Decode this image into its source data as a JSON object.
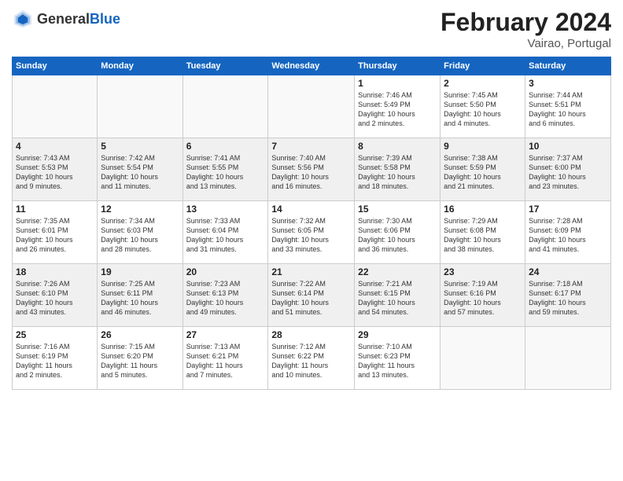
{
  "header": {
    "logo_general": "General",
    "logo_blue": "Blue",
    "month_year": "February 2024",
    "location": "Vairao, Portugal"
  },
  "days_of_week": [
    "Sunday",
    "Monday",
    "Tuesday",
    "Wednesday",
    "Thursday",
    "Friday",
    "Saturday"
  ],
  "weeks": [
    {
      "shaded": false,
      "days": [
        {
          "number": "",
          "info": ""
        },
        {
          "number": "",
          "info": ""
        },
        {
          "number": "",
          "info": ""
        },
        {
          "number": "",
          "info": ""
        },
        {
          "number": "1",
          "info": "Sunrise: 7:46 AM\nSunset: 5:49 PM\nDaylight: 10 hours\nand 2 minutes."
        },
        {
          "number": "2",
          "info": "Sunrise: 7:45 AM\nSunset: 5:50 PM\nDaylight: 10 hours\nand 4 minutes."
        },
        {
          "number": "3",
          "info": "Sunrise: 7:44 AM\nSunset: 5:51 PM\nDaylight: 10 hours\nand 6 minutes."
        }
      ]
    },
    {
      "shaded": true,
      "days": [
        {
          "number": "4",
          "info": "Sunrise: 7:43 AM\nSunset: 5:53 PM\nDaylight: 10 hours\nand 9 minutes."
        },
        {
          "number": "5",
          "info": "Sunrise: 7:42 AM\nSunset: 5:54 PM\nDaylight: 10 hours\nand 11 minutes."
        },
        {
          "number": "6",
          "info": "Sunrise: 7:41 AM\nSunset: 5:55 PM\nDaylight: 10 hours\nand 13 minutes."
        },
        {
          "number": "7",
          "info": "Sunrise: 7:40 AM\nSunset: 5:56 PM\nDaylight: 10 hours\nand 16 minutes."
        },
        {
          "number": "8",
          "info": "Sunrise: 7:39 AM\nSunset: 5:58 PM\nDaylight: 10 hours\nand 18 minutes."
        },
        {
          "number": "9",
          "info": "Sunrise: 7:38 AM\nSunset: 5:59 PM\nDaylight: 10 hours\nand 21 minutes."
        },
        {
          "number": "10",
          "info": "Sunrise: 7:37 AM\nSunset: 6:00 PM\nDaylight: 10 hours\nand 23 minutes."
        }
      ]
    },
    {
      "shaded": false,
      "days": [
        {
          "number": "11",
          "info": "Sunrise: 7:35 AM\nSunset: 6:01 PM\nDaylight: 10 hours\nand 26 minutes."
        },
        {
          "number": "12",
          "info": "Sunrise: 7:34 AM\nSunset: 6:03 PM\nDaylight: 10 hours\nand 28 minutes."
        },
        {
          "number": "13",
          "info": "Sunrise: 7:33 AM\nSunset: 6:04 PM\nDaylight: 10 hours\nand 31 minutes."
        },
        {
          "number": "14",
          "info": "Sunrise: 7:32 AM\nSunset: 6:05 PM\nDaylight: 10 hours\nand 33 minutes."
        },
        {
          "number": "15",
          "info": "Sunrise: 7:30 AM\nSunset: 6:06 PM\nDaylight: 10 hours\nand 36 minutes."
        },
        {
          "number": "16",
          "info": "Sunrise: 7:29 AM\nSunset: 6:08 PM\nDaylight: 10 hours\nand 38 minutes."
        },
        {
          "number": "17",
          "info": "Sunrise: 7:28 AM\nSunset: 6:09 PM\nDaylight: 10 hours\nand 41 minutes."
        }
      ]
    },
    {
      "shaded": true,
      "days": [
        {
          "number": "18",
          "info": "Sunrise: 7:26 AM\nSunset: 6:10 PM\nDaylight: 10 hours\nand 43 minutes."
        },
        {
          "number": "19",
          "info": "Sunrise: 7:25 AM\nSunset: 6:11 PM\nDaylight: 10 hours\nand 46 minutes."
        },
        {
          "number": "20",
          "info": "Sunrise: 7:23 AM\nSunset: 6:13 PM\nDaylight: 10 hours\nand 49 minutes."
        },
        {
          "number": "21",
          "info": "Sunrise: 7:22 AM\nSunset: 6:14 PM\nDaylight: 10 hours\nand 51 minutes."
        },
        {
          "number": "22",
          "info": "Sunrise: 7:21 AM\nSunset: 6:15 PM\nDaylight: 10 hours\nand 54 minutes."
        },
        {
          "number": "23",
          "info": "Sunrise: 7:19 AM\nSunset: 6:16 PM\nDaylight: 10 hours\nand 57 minutes."
        },
        {
          "number": "24",
          "info": "Sunrise: 7:18 AM\nSunset: 6:17 PM\nDaylight: 10 hours\nand 59 minutes."
        }
      ]
    },
    {
      "shaded": false,
      "days": [
        {
          "number": "25",
          "info": "Sunrise: 7:16 AM\nSunset: 6:19 PM\nDaylight: 11 hours\nand 2 minutes."
        },
        {
          "number": "26",
          "info": "Sunrise: 7:15 AM\nSunset: 6:20 PM\nDaylight: 11 hours\nand 5 minutes."
        },
        {
          "number": "27",
          "info": "Sunrise: 7:13 AM\nSunset: 6:21 PM\nDaylight: 11 hours\nand 7 minutes."
        },
        {
          "number": "28",
          "info": "Sunrise: 7:12 AM\nSunset: 6:22 PM\nDaylight: 11 hours\nand 10 minutes."
        },
        {
          "number": "29",
          "info": "Sunrise: 7:10 AM\nSunset: 6:23 PM\nDaylight: 11 hours\nand 13 minutes."
        },
        {
          "number": "",
          "info": ""
        },
        {
          "number": "",
          "info": ""
        }
      ]
    }
  ]
}
